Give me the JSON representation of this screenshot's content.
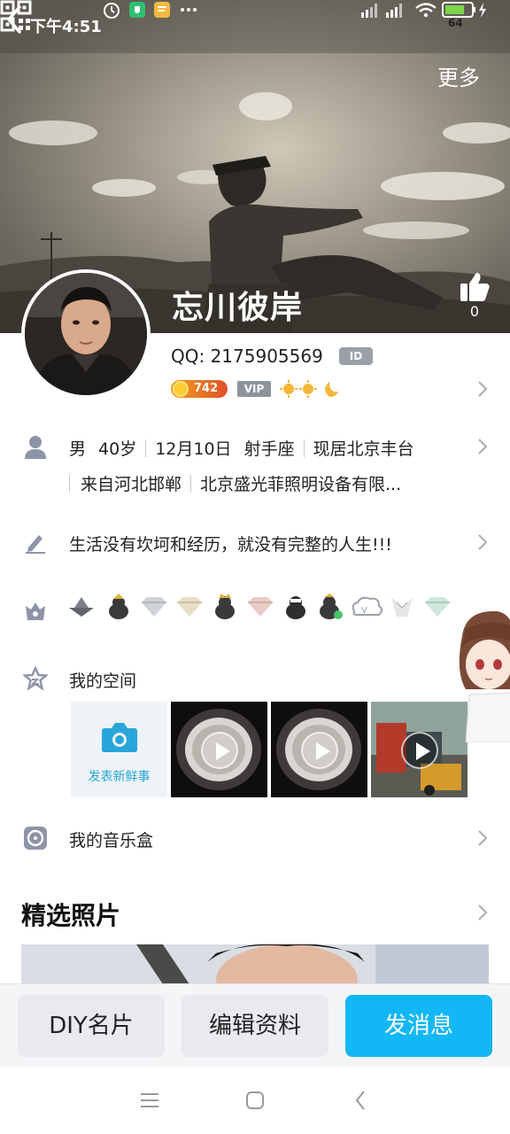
{
  "status_bar": {
    "time": "下午4:51",
    "battery": "64"
  },
  "header": {
    "more_label": "更多",
    "nickname": "忘川彼岸",
    "like_count": "0"
  },
  "profile": {
    "qq_label": "QQ: 2175905569",
    "id_badge": "ID",
    "coin_level": "742",
    "vip_label": "VIP"
  },
  "details": {
    "line1": [
      "男",
      "40岁",
      "12月10日",
      "射手座",
      "现居北京丰台"
    ],
    "line2": [
      "来自河北邯郸",
      "北京盛光菲照明设备有限..."
    ]
  },
  "signature": "生活没有坎坷和经历，就没有完整的人生!!!",
  "space": {
    "title": "我的空间",
    "post_label": "发表新鲜事"
  },
  "music": {
    "title": "我的音乐盒"
  },
  "photos": {
    "title": "精选照片"
  },
  "actions": {
    "diy": "DIY名片",
    "edit": "编辑资料",
    "send": "发消息"
  },
  "colors": {
    "accent": "#12b7f5",
    "icon_gray": "#8e94a8"
  }
}
